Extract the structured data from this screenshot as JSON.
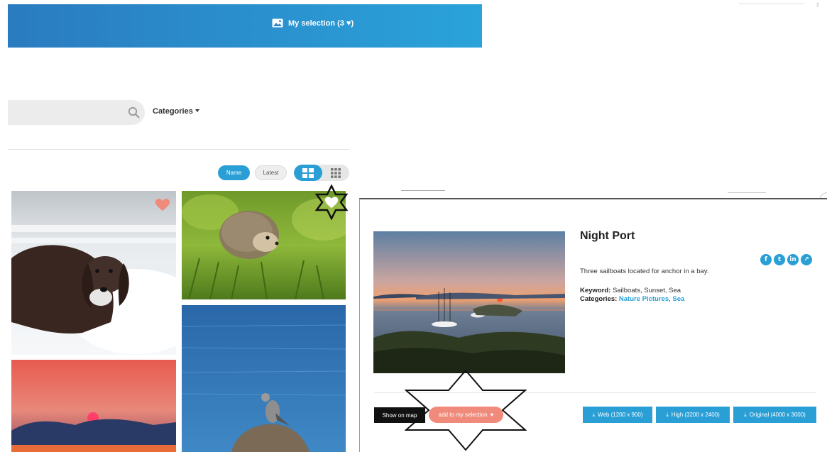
{
  "header": {
    "selection_label": "My selection (3 ",
    "selection_icon": "image-icon",
    "heart_glyph": "♥",
    "accent": "#2a9fd6"
  },
  "search": {
    "placeholder": "",
    "categories_label": "Categories"
  },
  "sort": {
    "name_label": "Name",
    "latest_label": "Latest",
    "active": "Name"
  },
  "grid": {
    "images": [
      {
        "subject": "dog-in-snow",
        "favorited": true
      },
      {
        "subject": "hedgehog-in-grass",
        "favorited": true
      },
      {
        "subject": "bird-on-rock-by-sea",
        "favorited": false
      },
      {
        "subject": "sunset-over-mountains",
        "favorited": false
      }
    ]
  },
  "detail": {
    "title": "Night Port",
    "description": "Three sailboats located for anchor in a bay.",
    "keyword_label": "Keyword:",
    "keywords": "Sailboats, Sunset, Sea",
    "categories_label": "Categories:",
    "category_1": "Nature Pictures",
    "category_sep": ",",
    "category_2": "Sea",
    "social": [
      "f",
      "t",
      "in",
      "↗"
    ],
    "show_on_map": "Show on map",
    "add_to_selection": "add to my selection",
    "downloads": {
      "web": "Web (1200 x 900)",
      "high": "High (3200 x 2400)",
      "original": "Original (4000 x 3000)"
    },
    "selection_color": "#f08a7a"
  }
}
